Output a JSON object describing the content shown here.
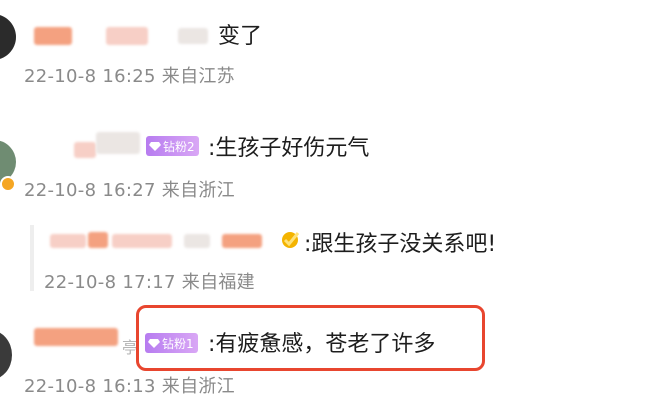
{
  "comments": [
    {
      "text": "变了",
      "meta": "22-10-8 16:25 来自江苏"
    },
    {
      "badge": "钻粉2",
      "text": ":生孩子好伤元气",
      "meta": "22-10-8 16:27 来自浙江"
    },
    {
      "text": ":跟生孩子没关系吧!",
      "meta": "22-10-8 17:17 来自福建"
    },
    {
      "name_tail": "亭",
      "badge": "钻粉1",
      "text": ":有疲惫感，苍老了许多",
      "meta": "22-10-8 16:13 来自浙江"
    }
  ],
  "colors": {
    "highlight_border": "#e8462f",
    "badge_purple": "#b77cf0",
    "meta_gray": "#8a8a8a"
  },
  "icons": [
    "diamond-badge-icon",
    "verified-v-icon"
  ]
}
